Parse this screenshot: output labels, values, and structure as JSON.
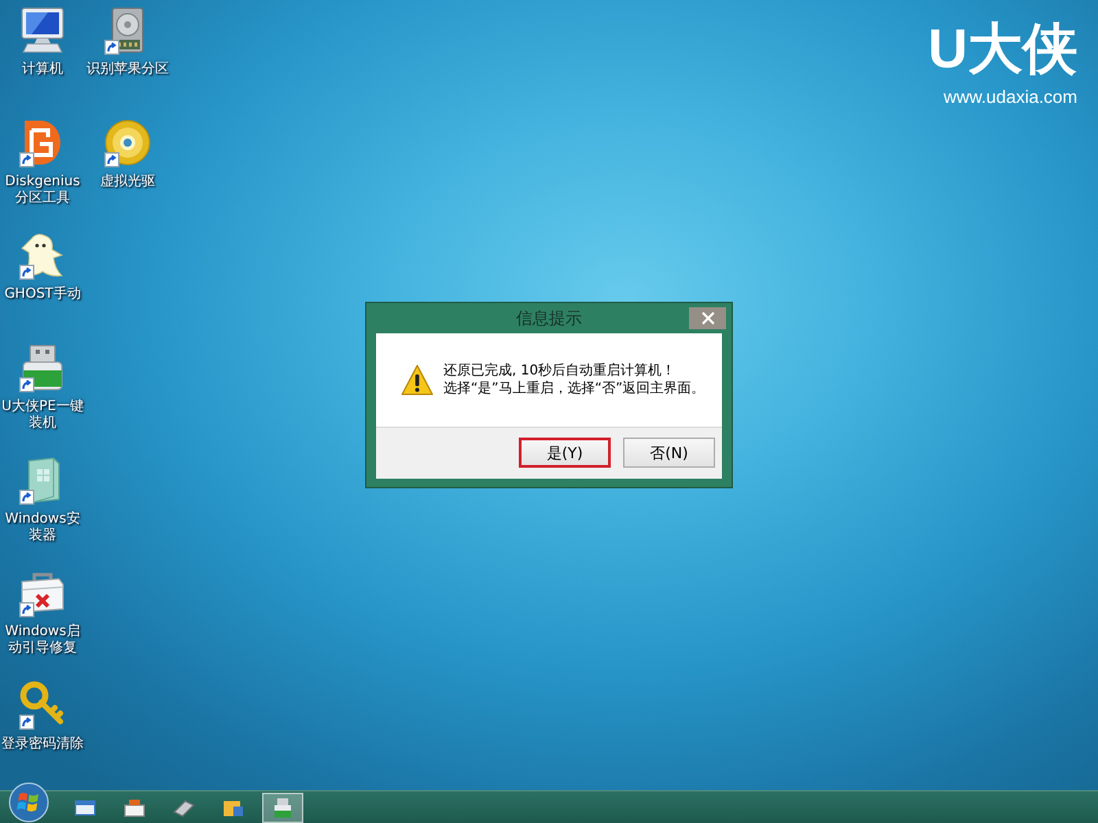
{
  "desktop_icons": [
    {
      "label": "计算机",
      "kind": "computer",
      "shortcut": false
    },
    {
      "label": "Diskgenius分区工具",
      "kind": "diskgenius",
      "shortcut": true
    },
    {
      "label": "GHOST手动",
      "kind": "ghost",
      "shortcut": true
    },
    {
      "label": "U大侠PE一键装机",
      "kind": "usb",
      "shortcut": true
    },
    {
      "label": "Windows安装器",
      "kind": "installer",
      "shortcut": true
    },
    {
      "label": "Windows启动引导修复",
      "kind": "toolbox",
      "shortcut": true
    },
    {
      "label": "登录密码清除",
      "kind": "key",
      "shortcut": true
    },
    {
      "label": "识别苹果分区",
      "kind": "drive",
      "shortcut": true
    },
    {
      "label": "虚拟光驱",
      "kind": "disc",
      "shortcut": true
    }
  ],
  "wallpaper_logo": {
    "title": "U大侠",
    "url": "www.udaxia.com"
  },
  "dialog": {
    "title": "信息提示",
    "message_lines": [
      "还原已完成, 10秒后自动重启计算机！",
      "选择“是”马上重启，选择“否”返回主界面。"
    ],
    "buttons": [
      {
        "label": "是(Y)",
        "focused": true
      },
      {
        "label": "否(N)",
        "focused": false
      }
    ]
  },
  "taskbar": {
    "items": [
      {
        "kind": "window",
        "selected": false
      },
      {
        "kind": "toolbox",
        "selected": false
      },
      {
        "kind": "drive",
        "selected": false
      },
      {
        "kind": "folder",
        "selected": false
      },
      {
        "kind": "usb",
        "selected": true
      }
    ]
  }
}
